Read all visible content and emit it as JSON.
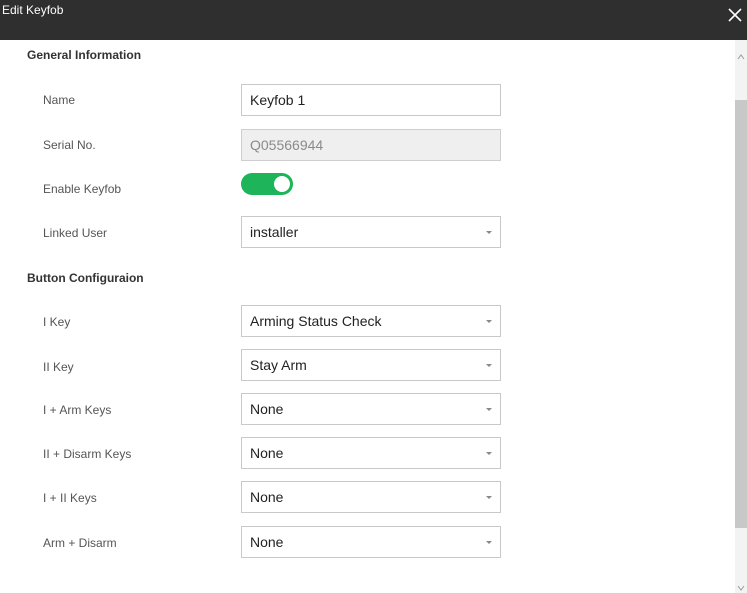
{
  "window": {
    "title": "Edit Keyfob"
  },
  "sections": {
    "general": "General Information",
    "buttons": "Button Configuraion"
  },
  "general": {
    "name_label": "Name",
    "name_value": "Keyfob 1",
    "serial_label": "Serial No.",
    "serial_value": "Q05566944",
    "enable_label": "Enable Keyfob",
    "enable_on": true,
    "linked_user_label": "Linked User",
    "linked_user_value": "installer"
  },
  "button_config": [
    {
      "label": "I Key",
      "value": "Arming Status Check"
    },
    {
      "label": "II Key",
      "value": "Stay Arm"
    },
    {
      "label": "I + Arm Keys",
      "value": "None"
    },
    {
      "label": "II + Disarm Keys",
      "value": "None"
    },
    {
      "label": "I + II Keys",
      "value": "None"
    },
    {
      "label": "Arm + Disarm",
      "value": "None"
    }
  ],
  "colors": {
    "titlebar": "#2f2f2f",
    "toggle_on": "#1db45a"
  },
  "icons": {
    "close": "close-icon",
    "dropdown": "chevron-down-icon",
    "scroll_up": "chevron-up-icon",
    "scroll_down": "chevron-down-icon"
  }
}
